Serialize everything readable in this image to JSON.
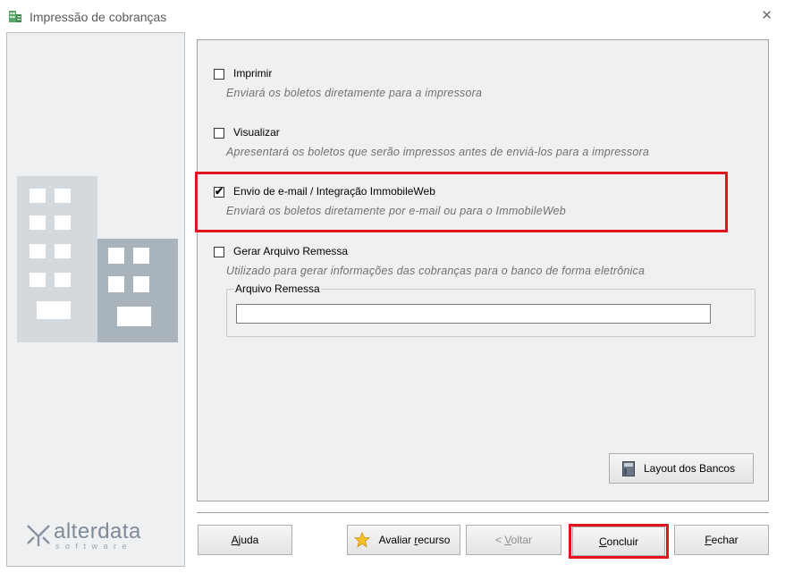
{
  "window": {
    "title": "Impressão de cobranças",
    "close_glyph": "✕",
    "app_icon": "building-icon"
  },
  "sidebar": {
    "logo_word": "alterdata",
    "logo_sub": "software"
  },
  "options": [
    {
      "label": "Imprimir",
      "description": "Enviará os boletos diretamente para a impressora",
      "checked": false
    },
    {
      "label": "Visualizar",
      "description": "Apresentará os boletos que serão impressos antes de enviá-los para a impressora",
      "checked": false
    },
    {
      "label": "Envio de e-mail / Integração ImmobileWeb",
      "description": "Enviará os boletos diretamente por e-mail ou para o ImmobileWeb",
      "checked": true
    },
    {
      "label": "Gerar Arquivo Remessa",
      "description": "Utilizado para gerar informações das cobranças para o banco de forma eletrônica",
      "checked": false
    }
  ],
  "check_glyph": "✔",
  "remessa_group": {
    "title": "Arquivo Remessa",
    "value": ""
  },
  "layout_button": {
    "label": "Layout dos Bancos",
    "icon": "book-icon"
  },
  "footer": {
    "help_pre": "",
    "help_key": "A",
    "help_post": "juda",
    "avaliar_pre": "Avaliar ",
    "avaliar_key": "r",
    "avaliar_post": "ecurso",
    "voltar_pre": "< ",
    "voltar_key": "V",
    "voltar_post": "oltar",
    "concluir_pre": "",
    "concluir_key": "C",
    "concluir_post": "oncluir",
    "fechar_pre": "",
    "fechar_key": "F",
    "fechar_post": "echar"
  },
  "colors": {
    "highlight": "#e3141d",
    "accent_blue": "#2b6fc0"
  }
}
